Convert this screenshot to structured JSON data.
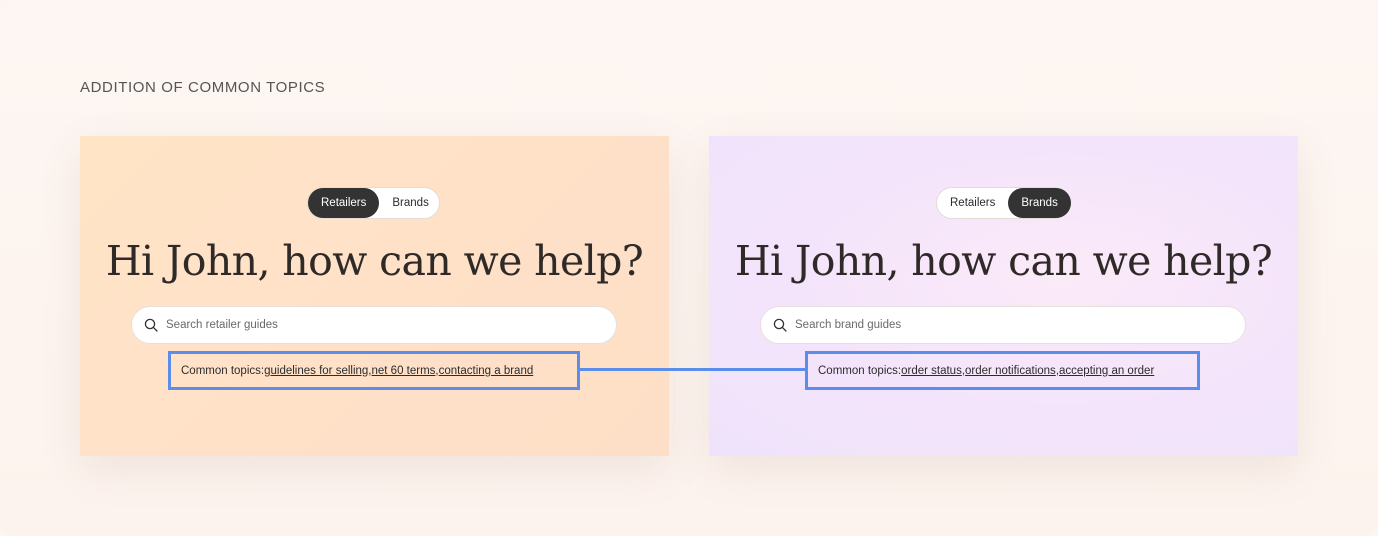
{
  "section_label": "ADDITION OF COMMON TOPICS",
  "accent_color": "#5b8dea",
  "left_panel": {
    "toggle": {
      "option1": "Retailers",
      "option2": "Brands",
      "active": "Retailers"
    },
    "headline": "Hi John, how can we help?",
    "search_placeholder": "Search retailer guides",
    "topics_label": "Common topics: ",
    "topics": [
      "guidelines for selling",
      "net 60 terms",
      "contacting a brand"
    ],
    "separator": ", "
  },
  "right_panel": {
    "toggle": {
      "option1": "Retailers",
      "option2": "Brands",
      "active": "Brands"
    },
    "headline": "Hi John, how can we help?",
    "search_placeholder": "Search brand guides",
    "topics_label": "Common topics: ",
    "topics": [
      "order status",
      "order notifications",
      "accepting an order"
    ],
    "separator": ", "
  }
}
